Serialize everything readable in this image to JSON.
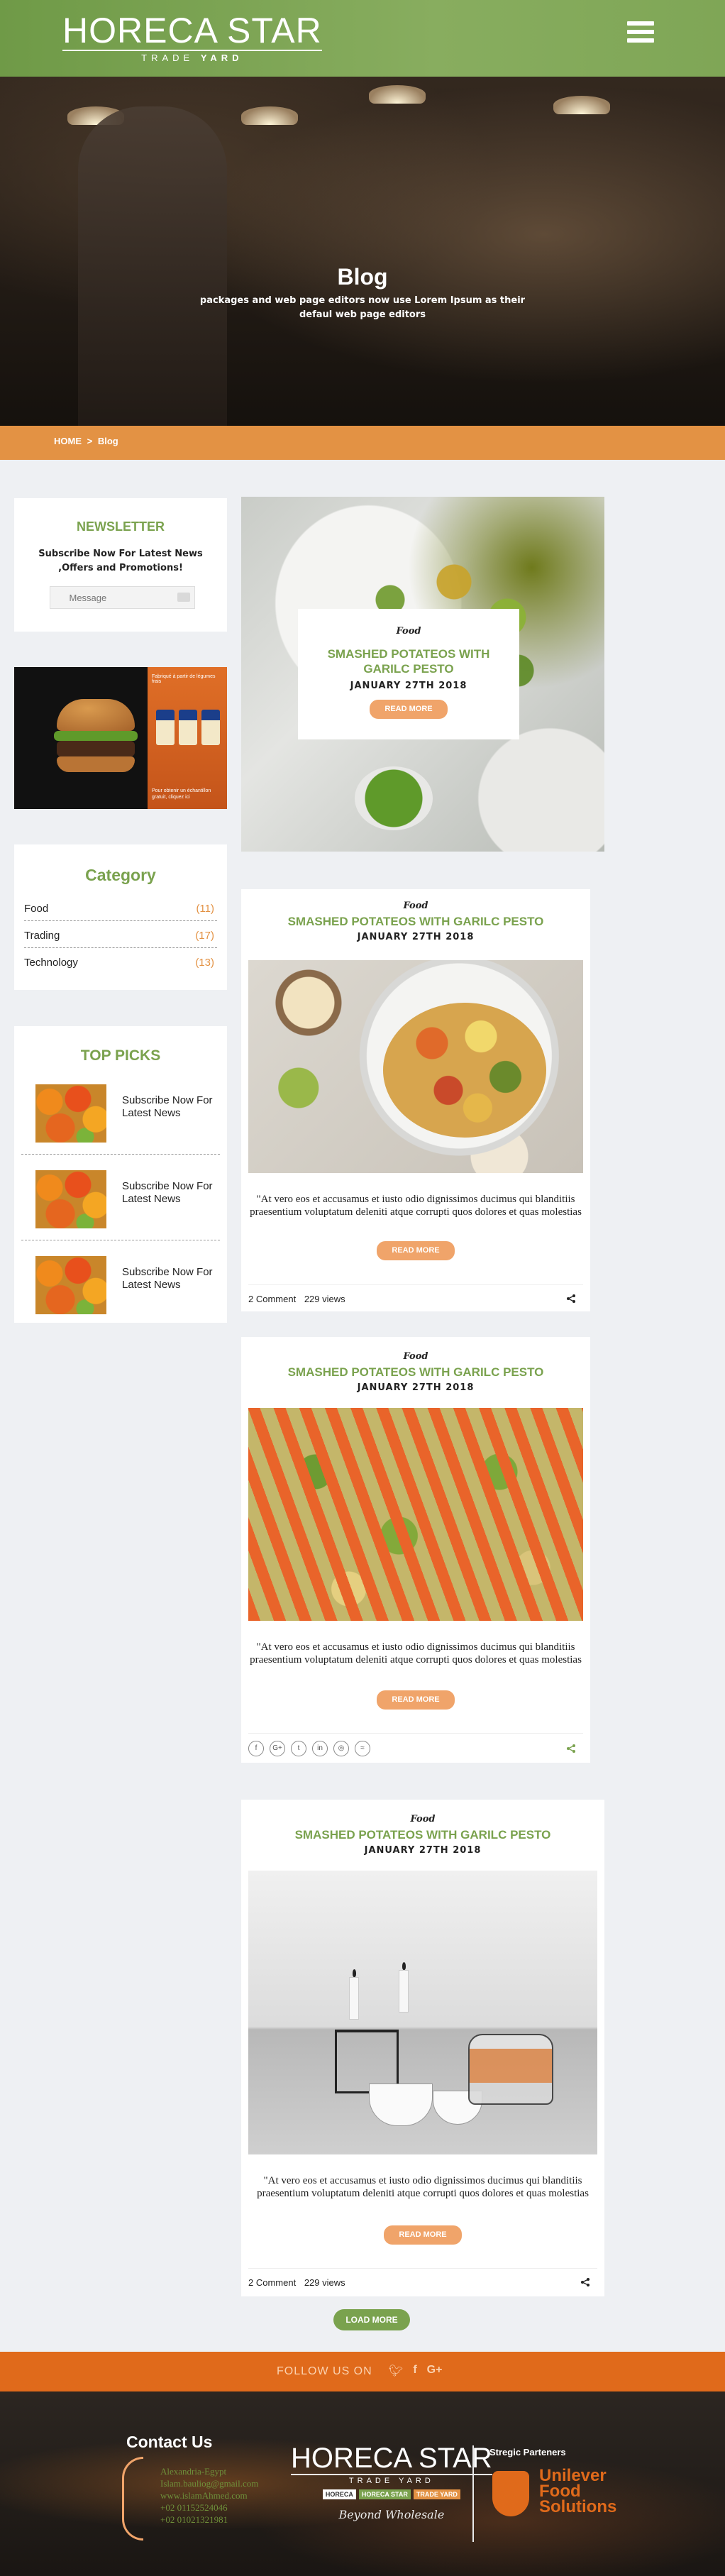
{
  "header": {
    "logo_main": "HORECA STAR",
    "logo_sub_1": "TRADE",
    "logo_sub_2": "YARD",
    "menu_icon": "hamburger-menu-icon"
  },
  "hero": {
    "title": "Blog",
    "text": "packages and web page editors now use Lorem Ipsum as their defaul web page editors"
  },
  "breadcrumb": {
    "home": "HOME",
    "separator": ">",
    "current": "Blog"
  },
  "newsletter": {
    "title": "NEWSLETTER",
    "text": "Subscribe Now For Latest News ,Offers and Promotions!",
    "placeholder": "Message",
    "icon": "mail-icon"
  },
  "ad": {
    "top_text": "Fabriqué à partir de légumes frais",
    "caption": "Pour obtenir un échantillon gratuit, cliquez ici"
  },
  "category": {
    "title": "Category",
    "items": [
      {
        "name": "Food",
        "count": "(11)"
      },
      {
        "name": "Trading",
        "count": "(17)"
      },
      {
        "name": "Technology",
        "count": "(13)"
      }
    ]
  },
  "top_picks": {
    "title": "TOP PICKS",
    "items": [
      {
        "text": "Subscribe Now For Latest News"
      },
      {
        "text": "Subscribe Now For Latest News"
      },
      {
        "text": "Subscribe Now For Latest News"
      }
    ]
  },
  "featured": {
    "category": "Food",
    "title": "SMASHED POTATEOS WITH GARILC PESTO",
    "date": "JANUARY 27TH 2018",
    "button": "READ MORE"
  },
  "posts": [
    {
      "category": "Food",
      "title": "SMASHED POTATEOS WITH GARILC PESTO",
      "date": "JANUARY 27TH 2018",
      "excerpt": "\"At vero eos et accusamus et iusto odio dignissimos ducimus qui blanditiis praesentium voluptatum deleniti atque corrupti quos dolores et quas molestias",
      "button": "READ MORE",
      "comments": "2 Comment",
      "views": "229 views"
    },
    {
      "category": "Food",
      "title": "SMASHED POTATEOS WITH GARILC PESTO",
      "date": "JANUARY 27TH 2018",
      "excerpt": "\"At vero eos et accusamus et iusto odio dignissimos ducimus qui blanditiis praesentium voluptatum deleniti atque corrupti quos dolores et quas molestias",
      "button": "READ MORE",
      "social": [
        "f",
        "G+",
        "t",
        "in",
        "◎",
        "≈"
      ]
    },
    {
      "category": "Food",
      "title": "SMASHED POTATEOS WITH GARILC PESTO",
      "date": "JANUARY 27TH 2018",
      "excerpt": "\"At vero eos et accusamus et iusto odio dignissimos ducimus qui blanditiis praesentium voluptatum deleniti atque corrupti quos dolores et quas molestias",
      "button": "READ MORE",
      "comments": "2 Comment",
      "views": "229 views"
    }
  ],
  "load_more": "LOAD MORE",
  "follow": {
    "text": "FOLLOW US ON",
    "icons": [
      "twitter-icon",
      "facebook-icon",
      "google-plus-icon"
    ]
  },
  "footer": {
    "contact_title": "Contact Us",
    "contact_lines": [
      "Alexandria-Egypt",
      "Islam.bauliog@gmail.com",
      "www.islamAhmed.com",
      "+02 01152524046",
      "+02 01021321981"
    ],
    "logo_main": "HORECA STAR",
    "logo_sub": "TRADE YARD",
    "tags": [
      "HORECA",
      "HORECA STAR",
      "TRADE YARD"
    ],
    "slogan": "Beyond Wholesale",
    "partners_title": "Stregic Parteners",
    "partner_name": "Unilever Food Solutions"
  },
  "colors": {
    "green": "#7aa24e",
    "orange": "#e39244",
    "follow_orange": "#e06a1b",
    "button_peach": "#f0a46a"
  }
}
